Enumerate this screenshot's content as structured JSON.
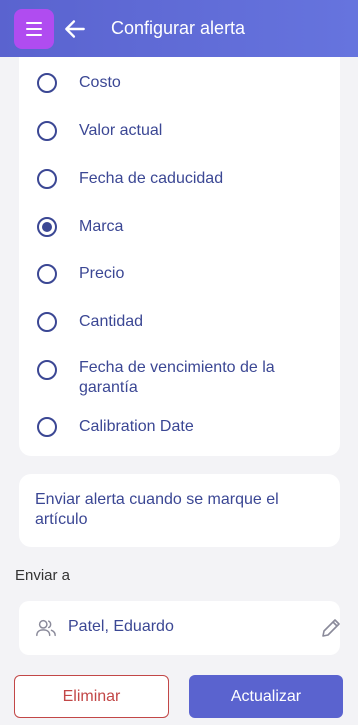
{
  "header": {
    "title": "Configurar alerta",
    "menu_icon": "hamburger-menu-icon",
    "back_icon": "arrow-left-icon",
    "menu_color": "#b04cf0",
    "bar_color": "#5a63cf"
  },
  "options": [
    {
      "label": "Costo",
      "selected": false
    },
    {
      "label": "Valor actual",
      "selected": false
    },
    {
      "label": "Fecha de caducidad",
      "selected": false
    },
    {
      "label": "Marca",
      "selected": true
    },
    {
      "label": "Precio",
      "selected": false
    },
    {
      "label": "Cantidad",
      "selected": false
    },
    {
      "label": "Fecha de vencimiento de la garantía",
      "selected": false
    },
    {
      "label": "Calibration Date",
      "selected": false
    }
  ],
  "send_condition": "Enviar alerta cuando se marque el artículo",
  "send_to": {
    "label": "Enviar a",
    "recipient": "Patel, Eduardo",
    "recipient_icon": "users-icon",
    "edit_icon": "pencil-icon"
  },
  "actions": {
    "delete_label": "Eliminar",
    "update_label": "Actualizar"
  }
}
